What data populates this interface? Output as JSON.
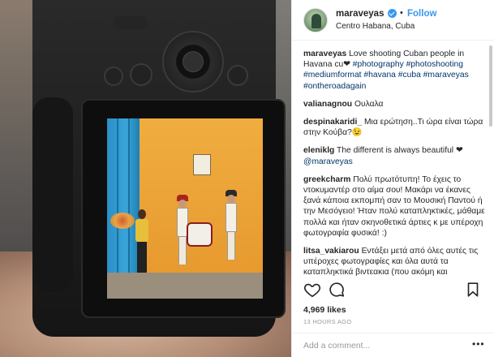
{
  "header": {
    "username": "maraveyas",
    "separator": "•",
    "follow_label": "Follow",
    "location": "Centro Habana, Cuba"
  },
  "caption": {
    "user": "maraveyas",
    "text": "Love shooting Cuban people in Havana cu❤",
    "hashtags": "#photography #photoshooting #mediumformat #havana #cuba #maraveyas #ontheroadagain"
  },
  "comments": [
    {
      "user": "valianagnou",
      "text": "Ουλαλα"
    },
    {
      "user": "despinakaridi_",
      "text": "Μια ερώτηση..Τι ώρα είναι τώρα στην Κούβα?😉"
    },
    {
      "user": "eleniklg",
      "text": "The different is always beautiful ❤ ",
      "mention": "@maraveyas"
    },
    {
      "user": "greekcharm",
      "text": "Πολύ πρωτότυπη! Το έχεις το ντοκυμαντέρ στο αίμα σου! Μακάρι να έκανες ξανά κάποια εκπομπή σαν το Μουσική Παντού ή την Μεσόγειο! Ήταν πολύ καταπληκτικές, μάθαμε πολλά και ήταν σκηνοθετικά άρτιες κ με υπέροχη φωτογραφία φυσικά! :)"
    },
    {
      "user": "litsa_vakiarou",
      "text": "Εντάξει μετά από όλες αυτές τις υπέροχες φωτογραφίες και όλα αυτά τα καταπληκτικά βιντεακια (που ακόμη και μεταδόσεις κάνει κάτι)"
    }
  ],
  "stats": {
    "likes": "4,969 likes",
    "time": "13 HOURS AGO"
  },
  "add_comment": {
    "placeholder": "Add a comment...",
    "more": "•••"
  },
  "icons": {
    "like": "heart-icon",
    "comment": "comment-bubble-icon",
    "save": "bookmark-icon",
    "verified": "verified-badge-icon"
  },
  "colors": {
    "link": "#3897f0",
    "hashtag": "#003569",
    "muted": "#999999"
  }
}
